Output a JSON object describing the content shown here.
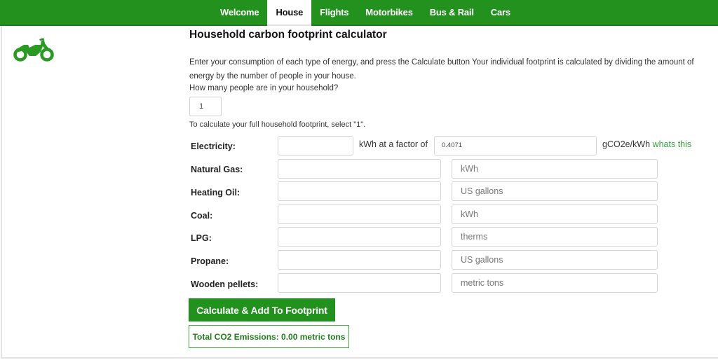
{
  "nav": {
    "tabs": [
      {
        "label": "Welcome",
        "active": false
      },
      {
        "label": "House",
        "active": true
      },
      {
        "label": "Flights",
        "active": false
      },
      {
        "label": "Motorbikes",
        "active": false
      },
      {
        "label": "Bus & Rail",
        "active": false
      },
      {
        "label": "Cars",
        "active": false
      }
    ]
  },
  "icon": "motorbike-icon",
  "colors": {
    "brand_green": "#22911d",
    "link_green": "#3aa142"
  },
  "page": {
    "title": "Household carbon footprint calculator",
    "description": "Enter your consumption of each type of energy, and press the Calculate button Your individual footprint is calculated by dividing the amount of energy by the number of people in your house.",
    "people_question": "How many people are in your household?",
    "people_value": "1",
    "people_hint": "To calculate your full household footprint, select \"1\"."
  },
  "electricity": {
    "label": "Electricity:",
    "value": "",
    "factor_prefix": "kWh at a factor of",
    "factor_value": "0.4071",
    "factor_suffix": "gCO2e/kWh",
    "help_link": "whats this"
  },
  "fuels": [
    {
      "label": "Natural Gas:",
      "value": "",
      "unit": "kWh"
    },
    {
      "label": "Heating Oil:",
      "value": "",
      "unit": "US gallons"
    },
    {
      "label": "Coal:",
      "value": "",
      "unit": "kWh"
    },
    {
      "label": "LPG:",
      "value": "",
      "unit": "therms"
    },
    {
      "label": "Propane:",
      "value": "",
      "unit": "US gallons"
    },
    {
      "label": "Wooden pellets:",
      "value": "",
      "unit": "metric tons"
    }
  ],
  "actions": {
    "calculate_label": "Calculate & Add To Footprint",
    "total_text": "Total CO2 Emissions: 0.00 metric tons"
  }
}
